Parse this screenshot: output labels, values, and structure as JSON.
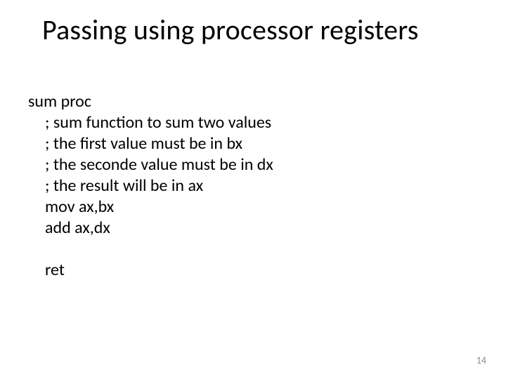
{
  "title": "Passing using processor registers",
  "code": {
    "l0": "sum proc",
    "l1": "; sum function to sum two values",
    "l2": "; the first value must be in bx",
    "l3": "; the seconde value must be in dx",
    "l4": "; the result will be in ax",
    "l5": "mov ax,bx",
    "l6": "add ax,dx",
    "gap": " ",
    "l7": "ret"
  },
  "page_number": "14"
}
